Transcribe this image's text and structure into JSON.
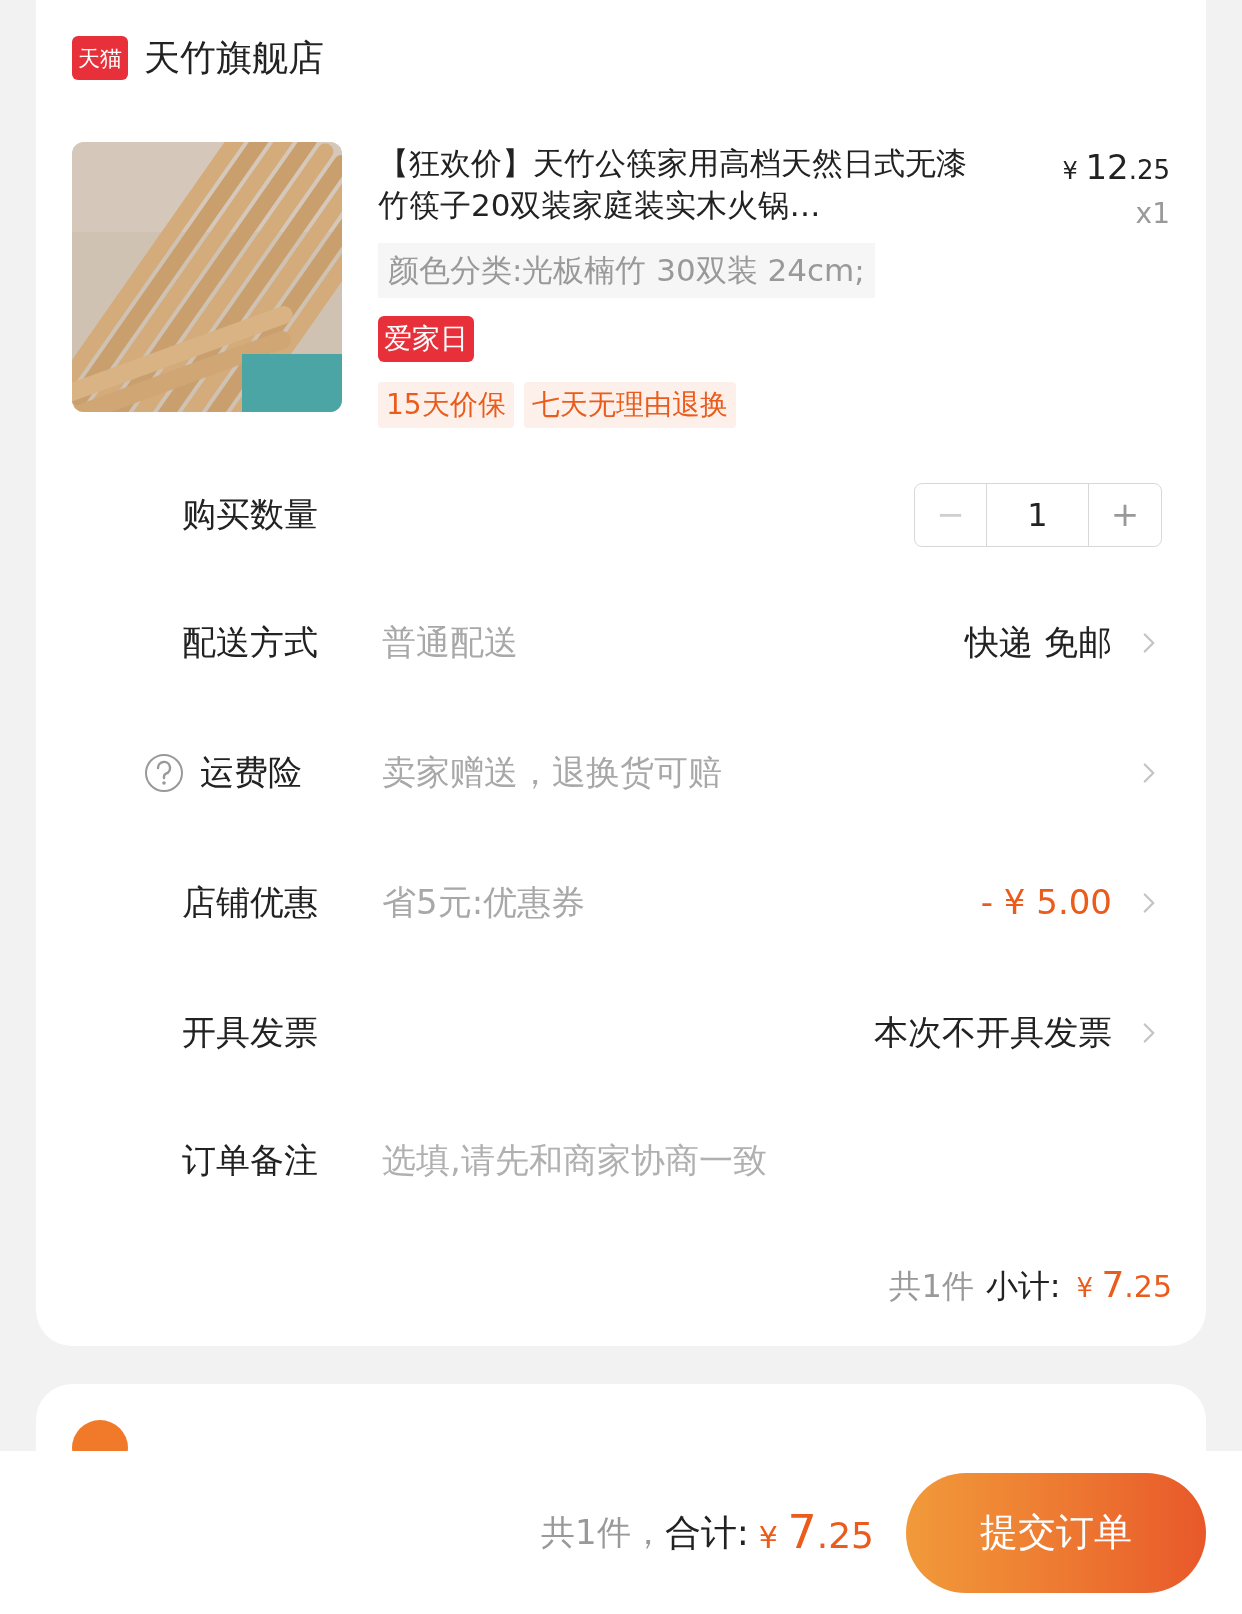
{
  "store": {
    "badge": "天猫",
    "name": "天竹旗舰店"
  },
  "product": {
    "title": "【狂欢价】天竹公筷家用高档天然日式无漆竹筷子20双装家庭装实木火锅…",
    "price_symbol": "¥",
    "price_int": "12",
    "price_dec": ".25",
    "qty": "x1",
    "sku": "颜色分类:光板楠竹 30双装 24cm;",
    "promo_tag": "爱家日",
    "service_tags": [
      "15天价保",
      "七天无理由退换"
    ]
  },
  "rows": [
    {
      "kind": "stepper",
      "label": "购买数量",
      "minus": "−",
      "value": "1",
      "plus": "+",
      "minus_disabled": true
    },
    {
      "kind": "select",
      "label": "配送方式",
      "desc": "普通配送",
      "value": "快递 免邮"
    },
    {
      "kind": "help",
      "label": "运费险",
      "desc": "卖家赠送，退换货可赔",
      "value": ""
    },
    {
      "kind": "discount",
      "label": "店铺优惠",
      "desc": "省5元:优惠券",
      "value": "- ¥ 5.00"
    },
    {
      "kind": "select",
      "label": "开具发票",
      "desc": "",
      "value": "本次不开具发票"
    },
    {
      "kind": "note",
      "label": "订单备注",
      "placeholder": "选填,请先和商家协商一致"
    }
  ],
  "subtotal": {
    "count": "共1件",
    "label": "小计:",
    "symbol": "¥",
    "int": "7",
    "dec": ".25"
  },
  "footer": {
    "count": "共1件，",
    "label": "合计:",
    "symbol": "¥",
    "int": "7",
    "dec": ".25",
    "submit": "提交订单"
  }
}
